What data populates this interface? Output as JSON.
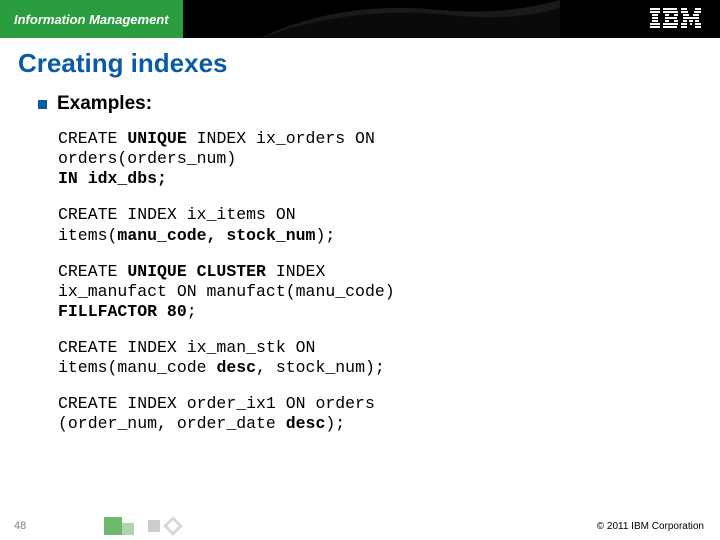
{
  "header": {
    "brand": "Information Management",
    "logo_label": "IBM"
  },
  "title": "Creating indexes",
  "bullet": "Examples:",
  "examples": [
    {
      "l1a": "CREATE ",
      "l1b": "UNIQUE",
      "l1c": " INDEX ix_orders ON",
      "l2a": "orders(orders_num)",
      "l3a": "IN idx_dbs;"
    },
    {
      "l1": "CREATE INDEX ix_items ON",
      "l2a": "items(",
      "l2b": "manu_code, stock_num",
      "l2c": ");"
    },
    {
      "l1a": "CREATE ",
      "l1b": "UNIQUE CLUSTER",
      "l1c": " INDEX",
      "l2": "ix_manufact ON manufact(manu_code)",
      "l3a": "FILLFACTOR 80",
      "l3b": ";"
    },
    {
      "l1": "CREATE INDEX ix_man_stk ON",
      "l2a": "items(manu_code ",
      "l2b": "desc",
      "l2c": ", stock_num);"
    },
    {
      "l1": "CREATE INDEX order_ix1 ON orders",
      "l2a": "(order_num, order_date ",
      "l2b": "desc",
      "l2c": ");"
    }
  ],
  "footer": {
    "page": "48",
    "copyright": "© 2011 IBM Corporation"
  }
}
